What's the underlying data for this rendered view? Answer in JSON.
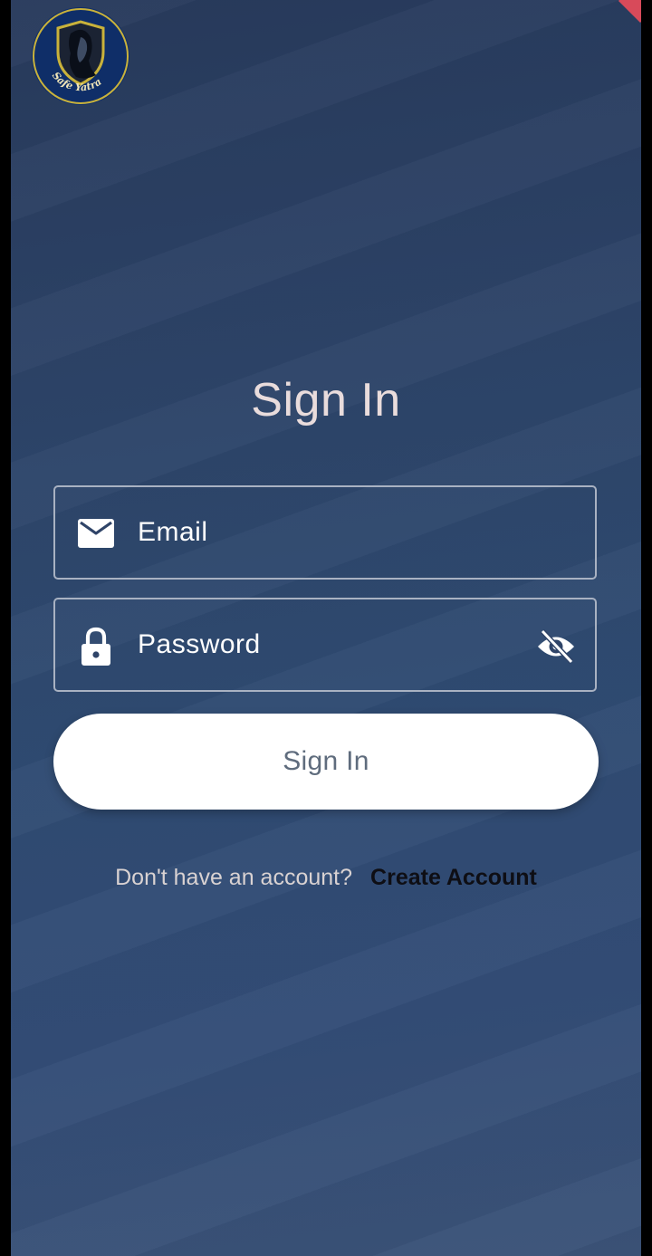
{
  "logo": {
    "text": "Safe Yatra",
    "ring_color": "#c9b23b",
    "badge_color": "#0f2e68"
  },
  "signin": {
    "title": "Sign In",
    "email_placeholder": "Email",
    "email_icon": "envelope-icon",
    "password_placeholder": "Password",
    "password_icon": "lock-icon",
    "visibility_icon": "eye-off-icon",
    "button_label": "Sign In"
  },
  "footer": {
    "prompt": "Don't have an account?",
    "link": "Create Account"
  },
  "colors": {
    "background_top": "#283a5c",
    "background_bottom": "#3b5378",
    "button_bg": "#ffffff",
    "button_text": "#5f6c7d",
    "accent": "#d84a5a"
  }
}
